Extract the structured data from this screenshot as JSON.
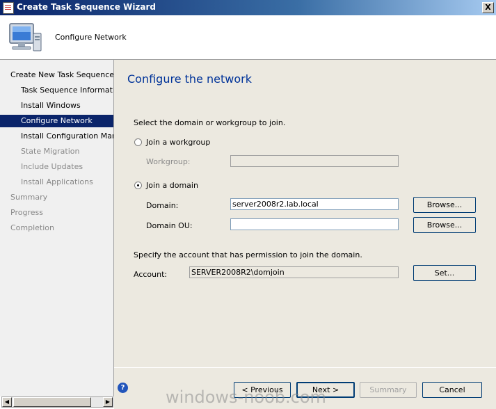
{
  "window": {
    "title": "Create Task Sequence Wizard",
    "close_glyph": "X"
  },
  "header": {
    "text": "Configure Network"
  },
  "nav": {
    "items": [
      {
        "label": "Create New Task Sequence",
        "state": "normal"
      },
      {
        "label": "Task Sequence Information",
        "state": "normal"
      },
      {
        "label": "Install Windows",
        "state": "normal"
      },
      {
        "label": "Configure Network",
        "state": "selected"
      },
      {
        "label": "Install Configuration Manag",
        "state": "normal"
      },
      {
        "label": "State Migration",
        "state": "disabled"
      },
      {
        "label": "Include Updates",
        "state": "disabled"
      },
      {
        "label": "Install Applications",
        "state": "disabled"
      },
      {
        "label": "Summary",
        "state": "disabled"
      },
      {
        "label": "Progress",
        "state": "disabled"
      },
      {
        "label": "Completion",
        "state": "disabled"
      }
    ]
  },
  "page": {
    "title": "Configure the network",
    "instruction": "Select the domain or workgroup to join.",
    "workgroup_radio": "Join a workgroup",
    "workgroup_label": "Workgroup:",
    "workgroup_value": "",
    "domain_radio": "Join a domain",
    "domain_label": "Domain:",
    "domain_value": "server2008r2.lab.local",
    "domain_ou_label": "Domain OU:",
    "domain_ou_value": "",
    "browse_label": "Browse...",
    "account_instruction": "Specify the account that has permission to join the domain.",
    "account_label": "Account:",
    "account_value": "SERVER2008R2\\domjoin",
    "set_label": "Set..."
  },
  "footer": {
    "previous": "< Previous",
    "next": "Next >",
    "summary": "Summary",
    "cancel": "Cancel",
    "help_glyph": "?"
  },
  "watermark": "windows-noob.com"
}
